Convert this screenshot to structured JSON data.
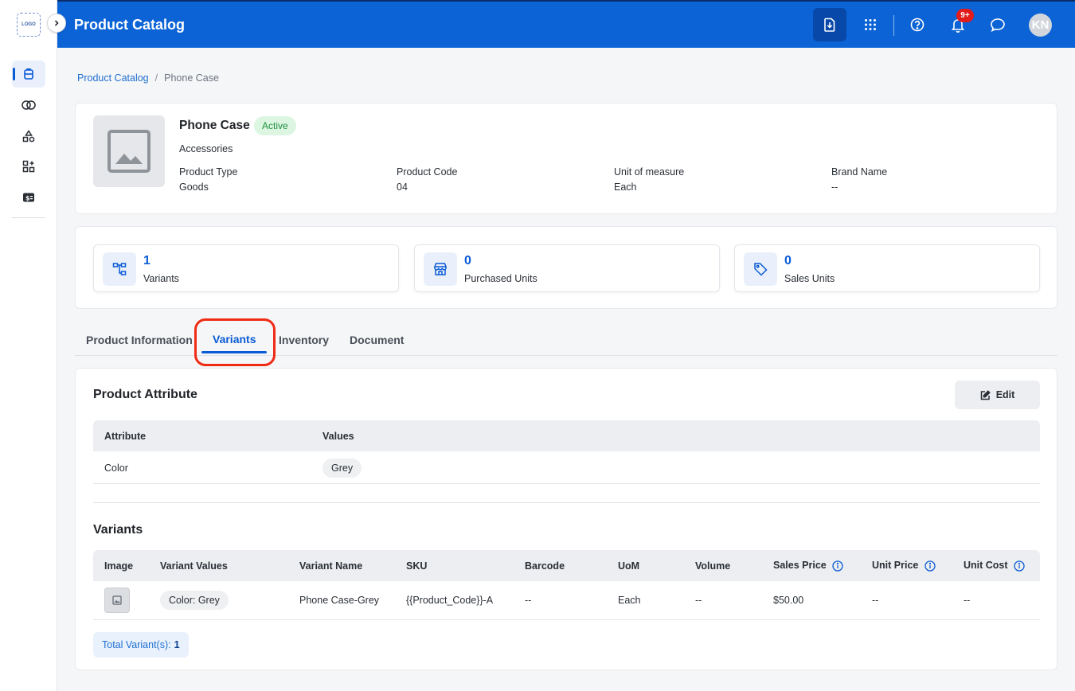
{
  "sidebar": {
    "logo": "LOGO",
    "items": [
      {
        "name": "sidebar-item-products",
        "icon": "box-icon",
        "active": true
      },
      {
        "name": "sidebar-item-links",
        "icon": "rings-icon"
      },
      {
        "name": "sidebar-item-shapes",
        "icon": "shapes-icon"
      },
      {
        "name": "sidebar-item-apps",
        "icon": "apps-icon"
      },
      {
        "name": "sidebar-item-billing",
        "icon": "cash-icon"
      }
    ]
  },
  "header": {
    "title": "Product Catalog",
    "notification_count": "9+",
    "avatar_initials": "KN"
  },
  "breadcrumb": {
    "root": "Product Catalog",
    "separator": "/",
    "current": "Phone Case"
  },
  "product": {
    "name": "Phone Case",
    "status": "Active",
    "category": "Accessories",
    "attributes": [
      {
        "label": "Product Type",
        "value": "Goods"
      },
      {
        "label": "Product Code",
        "value": "04"
      },
      {
        "label": "Unit of measure",
        "value": "Each"
      },
      {
        "label": "Brand Name",
        "value": "--"
      }
    ]
  },
  "stats": [
    {
      "value": "1",
      "label": "Variants"
    },
    {
      "value": "0",
      "label": "Purchased Units"
    },
    {
      "value": "0",
      "label": "Sales Units"
    }
  ],
  "tabs": [
    "Product Information",
    "Variants",
    "Inventory",
    "Document"
  ],
  "active_tab": "Variants",
  "attribute_section": {
    "title": "Product Attribute",
    "edit_label": "Edit",
    "columns": [
      "Attribute",
      "Values"
    ],
    "rows": [
      {
        "attribute": "Color",
        "value": "Grey"
      }
    ]
  },
  "variants_section": {
    "title": "Variants",
    "columns": [
      "Image",
      "Variant Values",
      "Variant Name",
      "SKU",
      "Barcode",
      "UoM",
      "Volume",
      "Sales Price",
      "Unit Price",
      "Unit Cost"
    ],
    "rows": [
      {
        "variant_values": "Color: Grey",
        "variant_name": "Phone Case-Grey",
        "sku": "{{Product_Code}}-A",
        "barcode": "--",
        "uom": "Each",
        "volume": "--",
        "sales_price": "$50.00",
        "unit_price": "--",
        "unit_cost": "--"
      }
    ],
    "total_label": "Total Variant(s):",
    "total_value": "1"
  },
  "colors": {
    "primary": "#0b63d6",
    "highlight": "#ef2b15",
    "active_status": "#1e8f3f"
  }
}
